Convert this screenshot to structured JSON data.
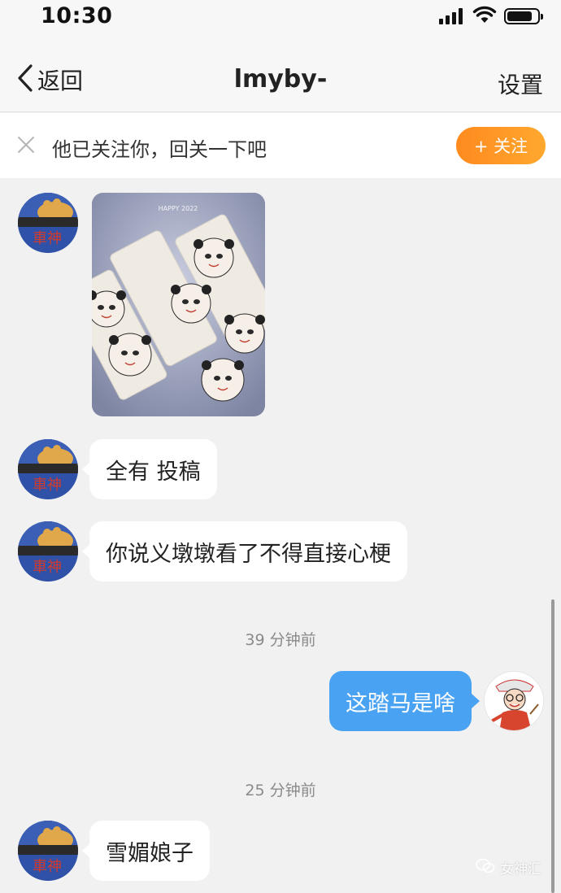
{
  "status_bar": {
    "time": "10:30"
  },
  "nav": {
    "back_label": "返回",
    "title": "lmyby-",
    "settings_label": "设置"
  },
  "follow_bar": {
    "text": "他已关注你，回关一下吧",
    "button_label": "+ 关注"
  },
  "image_message": {
    "watermark_text": "HAPPY 2022"
  },
  "messages": [
    {
      "sender": "other",
      "text": "全有 投稿"
    },
    {
      "sender": "other",
      "text": "你说义墩墩看了不得直接心梗"
    },
    {
      "sender": "self",
      "text": "这踏马是啥"
    },
    {
      "sender": "other",
      "text": "雪媚娘子"
    }
  ],
  "timestamps": [
    "39 分钟前",
    "25 分钟前"
  ],
  "avatar": {
    "label": "車神"
  },
  "watermark": {
    "text": "女神汇"
  },
  "colors": {
    "accent_orange": "#ff9523",
    "self_bubble": "#4aa3f2",
    "background": "#f1f1f1"
  }
}
